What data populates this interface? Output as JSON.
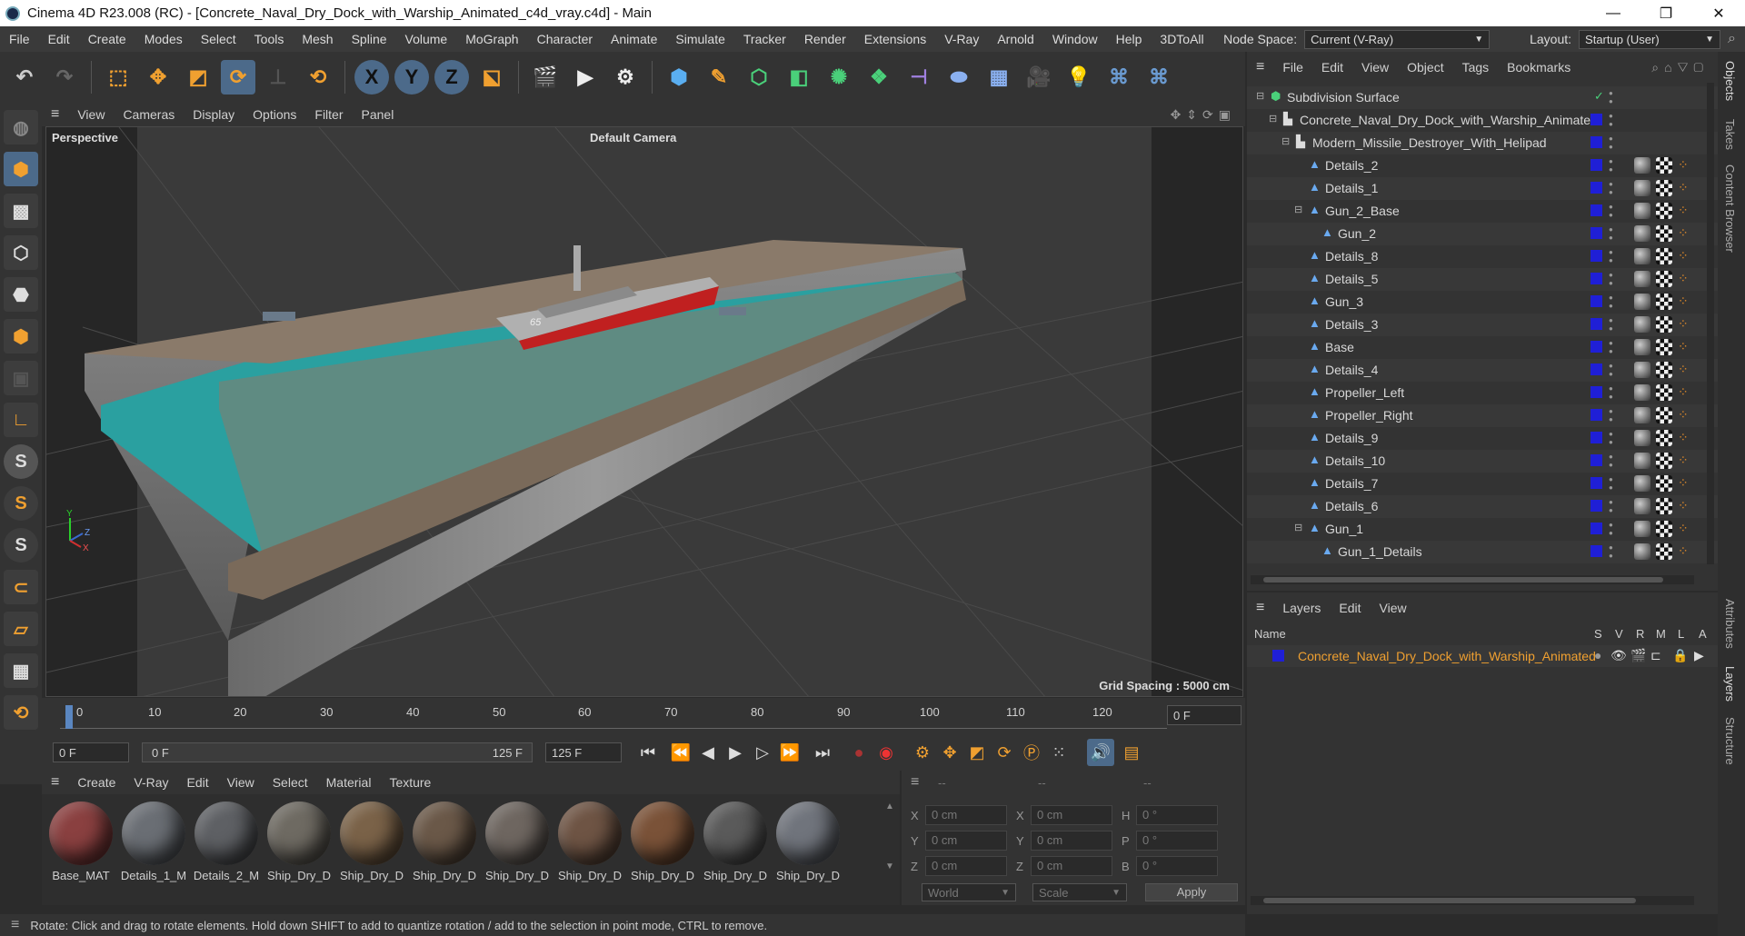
{
  "window": {
    "title": "Cinema 4D R23.008 (RC) - [Concrete_Naval_Dry_Dock_with_Warship_Animated_c4d_vray.c4d] - Main",
    "controls": [
      "—",
      "❐",
      "✕"
    ]
  },
  "menu": [
    "File",
    "Edit",
    "Create",
    "Modes",
    "Select",
    "Tools",
    "Mesh",
    "Spline",
    "Volume",
    "MoGraph",
    "Character",
    "Animate",
    "Simulate",
    "Tracker",
    "Render",
    "Extensions",
    "V-Ray",
    "Arnold",
    "Window",
    "Help",
    "3DToAll"
  ],
  "node_space": {
    "label": "Node Space:",
    "value": "Current (V-Ray)"
  },
  "layout": {
    "label": "Layout:",
    "value": "Startup (User)"
  },
  "toolbar": {
    "x": "X",
    "y": "Y",
    "z": "Z"
  },
  "viewport": {
    "menu": [
      "View",
      "Cameras",
      "Display",
      "Options",
      "Filter",
      "Panel"
    ],
    "label": "Perspective",
    "camera": "Default Camera",
    "grid": "Grid Spacing : 5000 cm",
    "hull_number": "65",
    "axis_y": "Y",
    "axis_z": "Z",
    "axis_x": "X"
  },
  "timeline": {
    "ticks": [
      "0",
      "10",
      "20",
      "30",
      "40",
      "50",
      "60",
      "70",
      "80",
      "90",
      "100",
      "110",
      "120"
    ],
    "current_frame": "0 F"
  },
  "playback": {
    "start": "0 F",
    "range_start": "0 F",
    "range_end": "125 F",
    "end": "125 F"
  },
  "materials": {
    "menu": [
      "Create",
      "V-Ray",
      "Edit",
      "View",
      "Select",
      "Material",
      "Texture"
    ],
    "items": [
      {
        "name": "Base_MAT",
        "color": "#8a4040"
      },
      {
        "name": "Details_1_M",
        "color": "#6a6e74"
      },
      {
        "name": "Details_2_M",
        "color": "#5e6064"
      },
      {
        "name": "Ship_Dry_D",
        "color": "#6e6a62"
      },
      {
        "name": "Ship_Dry_D",
        "color": "#7a6248"
      },
      {
        "name": "Ship_Dry_D",
        "color": "#6a5848"
      },
      {
        "name": "Ship_Dry_D",
        "color": "#6e6660"
      },
      {
        "name": "Ship_Dry_D",
        "color": "#6e5444"
      },
      {
        "name": "Ship_Dry_D",
        "color": "#7a5238"
      },
      {
        "name": "Ship_Dry_D",
        "color": "#5a5a5a"
      },
      {
        "name": "Ship_Dry_D",
        "color": "#70747c"
      }
    ]
  },
  "coords": {
    "header": [
      "--",
      "--",
      "--"
    ],
    "rows": [
      {
        "a": "X",
        "av": "0 cm",
        "b": "X",
        "bv": "0 cm",
        "c": "H",
        "cv": "0 °"
      },
      {
        "a": "Y",
        "av": "0 cm",
        "b": "Y",
        "bv": "0 cm",
        "c": "P",
        "cv": "0 °"
      },
      {
        "a": "Z",
        "av": "0 cm",
        "b": "Z",
        "bv": "0 cm",
        "c": "B",
        "cv": "0 °"
      }
    ],
    "world": "World",
    "scale": "Scale",
    "apply": "Apply"
  },
  "status": "Rotate: Click and drag to rotate elements. Hold down SHIFT to add to quantize rotation / add to the selection in point mode, CTRL to remove.",
  "objects": {
    "menu": [
      "File",
      "Edit",
      "View",
      "Object",
      "Tags",
      "Bookmarks"
    ],
    "items": [
      {
        "name": "Subdivision Surface",
        "level": 0
      },
      {
        "name": "Concrete_Naval_Dry_Dock_with_Warship_Animated",
        "level": 1
      },
      {
        "name": "Modern_Missile_Destroyer_With_Helipad",
        "level": 2
      },
      {
        "name": "Details_2",
        "level": 3
      },
      {
        "name": "Details_1",
        "level": 3
      },
      {
        "name": "Gun_2_Base",
        "level": 3
      },
      {
        "name": "Gun_2",
        "level": 4
      },
      {
        "name": "Details_8",
        "level": 3
      },
      {
        "name": "Details_5",
        "level": 3
      },
      {
        "name": "Gun_3",
        "level": 3
      },
      {
        "name": "Details_3",
        "level": 3
      },
      {
        "name": "Base",
        "level": 3
      },
      {
        "name": "Details_4",
        "level": 3
      },
      {
        "name": "Propeller_Left",
        "level": 3
      },
      {
        "name": "Propeller_Right",
        "level": 3
      },
      {
        "name": "Details_9",
        "level": 3
      },
      {
        "name": "Details_10",
        "level": 3
      },
      {
        "name": "Details_7",
        "level": 3
      },
      {
        "name": "Details_6",
        "level": 3
      },
      {
        "name": "Gun_1",
        "level": 3
      },
      {
        "name": "Gun_1_Details",
        "level": 4
      }
    ]
  },
  "layers": {
    "menu": [
      "Layers",
      "Edit",
      "View"
    ],
    "name_header": "Name",
    "cols": [
      "S",
      "V",
      "R",
      "M",
      "L",
      "A"
    ],
    "item": "Concrete_Naval_Dry_Dock_with_Warship_Animated"
  },
  "side_tabs": [
    "Objects",
    "Takes",
    "Content Browser",
    "Attributes",
    "Layers",
    "Structure"
  ]
}
